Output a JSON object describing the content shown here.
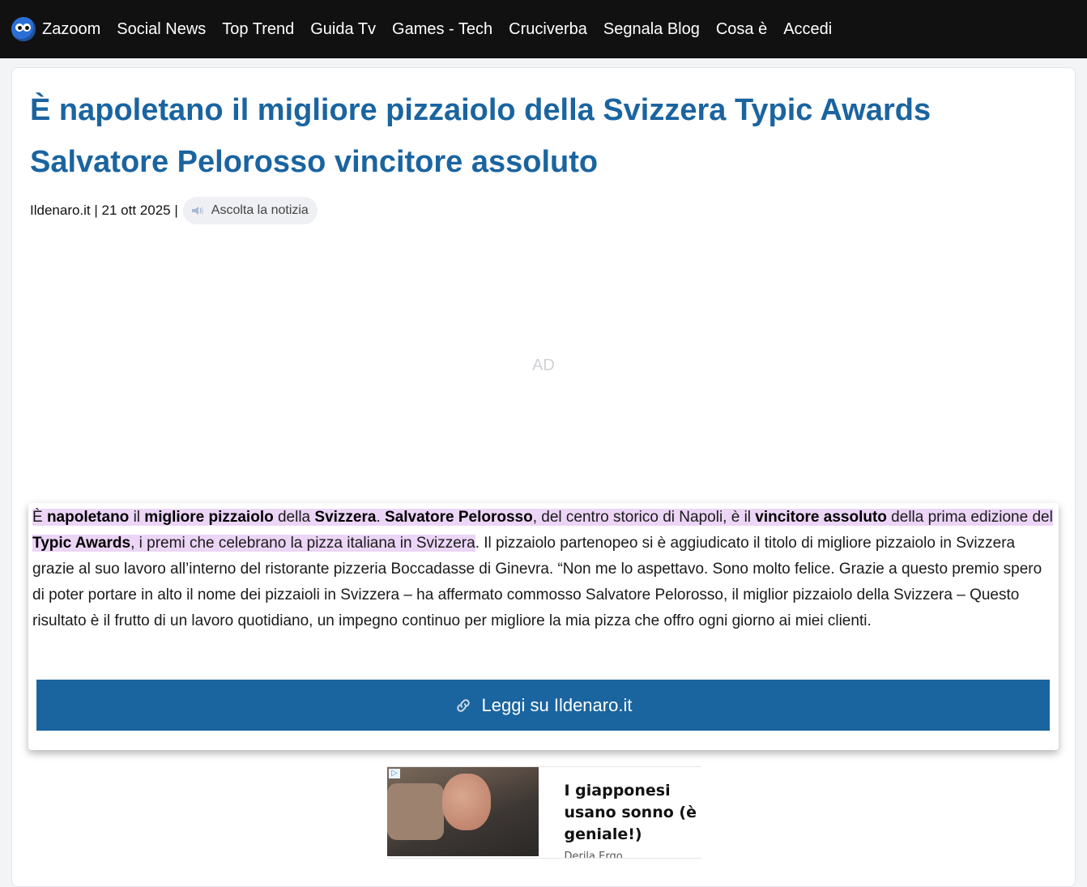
{
  "nav": {
    "logo": "Zazoom",
    "items": [
      "Social News",
      "Top Trend",
      "Guida Tv",
      "Games - Tech",
      "Cruciverba",
      "Segnala Blog",
      "Cosa è",
      "Accedi"
    ]
  },
  "article": {
    "title": "È napoletano il migliore pizzaiolo della Svizzera Typic Awards Salvatore Pelorosso vincitore assoluto",
    "source": "Ildenaro.it",
    "sep1": " | ",
    "date": "21 ott 2025",
    "sep2": " |",
    "listen_label": "Ascolta la notizia",
    "ad_label": "AD",
    "body": {
      "p1": "È ",
      "b1": "napoletano",
      "p2": " il ",
      "b2": "migliore pizzaiolo",
      "p3": " della ",
      "b3": "Svizzera",
      "p4": ". ",
      "b4": "Salvatore Pelorosso",
      "p5": ", del centro storico di Napoli, è il ",
      "b5": "vincitore assoluto",
      "p6": " della prima edizione del ",
      "b6": "Typic Awards",
      "p7": ", i premi che celebrano la pizza italiana in Svizzera",
      "rest": ". Il pizzaiolo partenopeo si è aggiudicato il titolo di migliore pizzaiolo in Svizzera grazie al suo lavoro all’interno del ristorante pizzeria Boccadasse di Ginevra.  “Non me lo aspettavo. Sono molto felice. Grazie a questo premio spero di poter portare in alto il nome dei pizzaioli in Svizzera – ha affermato commosso Salvatore Pelorosso, il miglior pizzaiolo della Svizzera – Questo risultato è il frutto di un lavoro quotidiano, un impegno continuo per migliore la mia pizza che offro ogni giorno ai miei clienti."
    },
    "read_button": "Leggi su Ildenaro.it"
  },
  "sponsored": {
    "headline": "I giapponesi usano sonno (è geniale!)",
    "source": "Derila Ergo"
  },
  "colors": {
    "nav_bg": "#111111",
    "accent": "#1a64a0",
    "highlight": "#ecd5f6"
  }
}
